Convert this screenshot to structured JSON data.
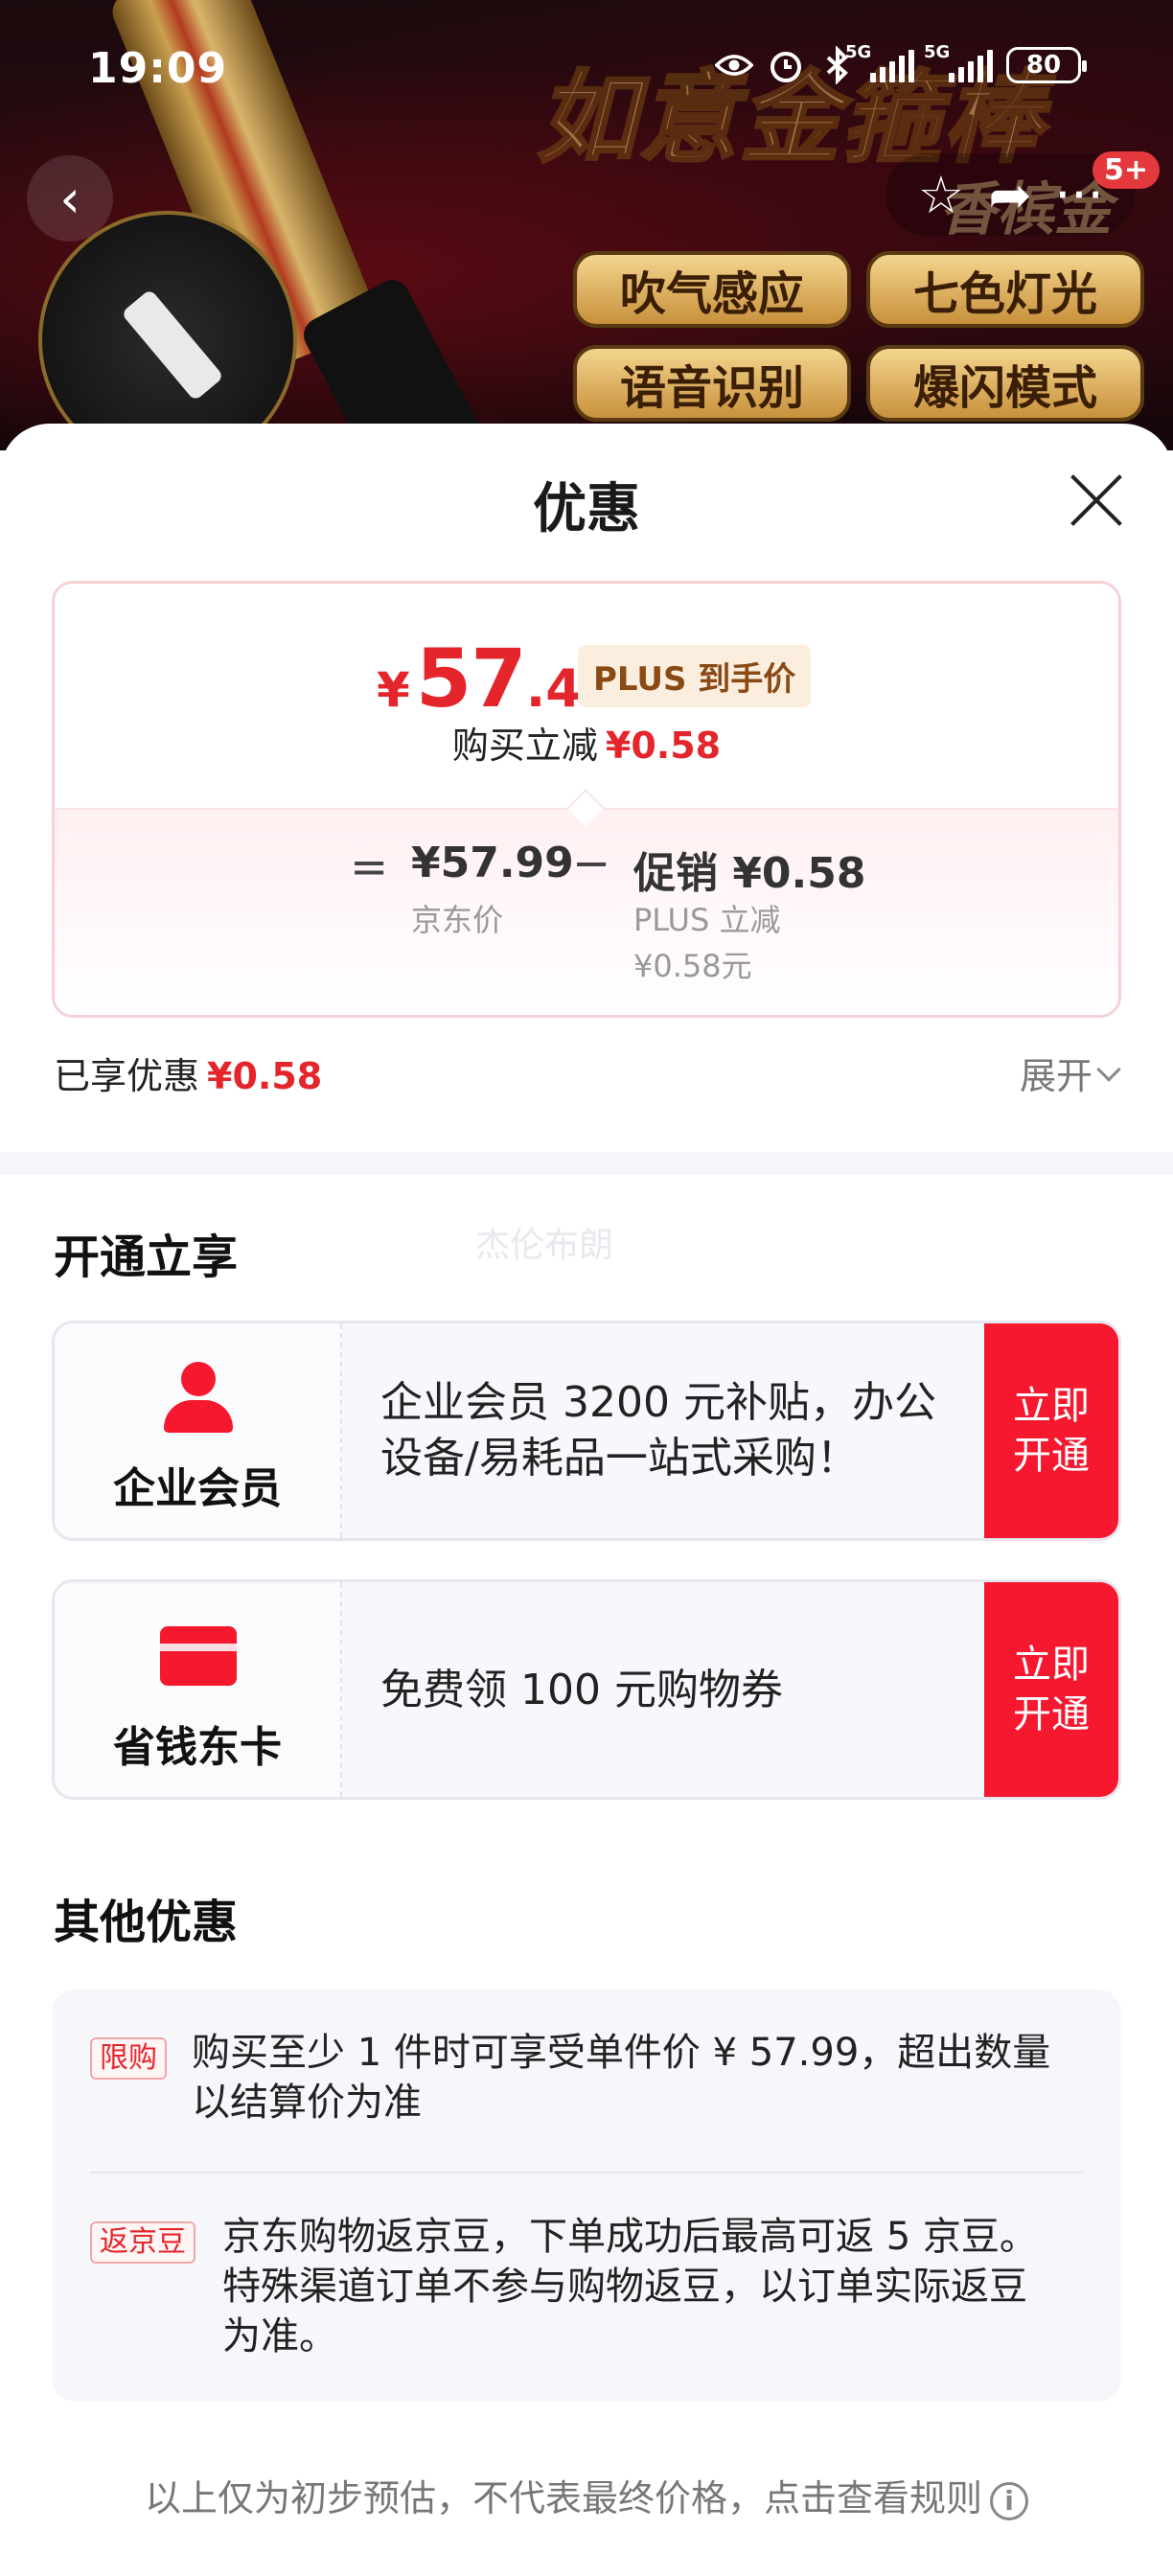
{
  "status_bar": {
    "time": "19:09",
    "network1": "5G",
    "network2": "5G",
    "battery": "80"
  },
  "banner": {
    "title_art": "如意金箍棒",
    "sub_art": "香槟金",
    "badge_count": "5+",
    "features": [
      "吹气感应",
      "七色灯光",
      "语音识别",
      "爆闪模式"
    ]
  },
  "sheet": {
    "title": "优惠",
    "price": {
      "currency": "¥",
      "integer": "57",
      "decimal": ".41",
      "plus_tag": "PLUS 到手价",
      "reduce_label": "购买立减",
      "reduce_amount": "¥0.58",
      "equals": "=",
      "jd_price": "¥57.99",
      "jd_price_label": "京东价",
      "minus": "−",
      "promo_value": "促销 ¥0.58",
      "promo_sub1": "PLUS 立减",
      "promo_sub2": "¥0.58元"
    },
    "enjoyed_label": "已享优惠",
    "enjoyed_amount": "¥0.58",
    "expand_label": "展开"
  },
  "open_section": {
    "title": "开通立享",
    "watermark": "杰伦布朗",
    "cards": [
      {
        "name": "企业会员",
        "icon": "user-icon",
        "desc_line1": "企业会员 3200 元补贴，办公",
        "desc_line2": "设备/易耗品一站式采购！",
        "cta_line1": "立即",
        "cta_line2": "开通"
      },
      {
        "name": "省钱东卡",
        "icon": "card-icon",
        "desc_line1": "免费领 100 元购物券",
        "cta_line1": "立即",
        "cta_line2": "开通"
      }
    ]
  },
  "other_section": {
    "title": "其他优惠",
    "items": [
      {
        "tag": "限购",
        "line1": "购买至少 1 件时可享受单件价 ¥ 57.99，超出数量",
        "line2": "以结算价为准"
      },
      {
        "tag": "返京豆",
        "line1": "京东购物返京豆，下单成功后最高可返 5 京豆。",
        "line2": "特殊渠道订单不参与购物返豆，以订单实际返豆",
        "line3": "为准。"
      }
    ]
  },
  "footer": {
    "note": "以上仅为初步预估，不代表最终价格，点击查看规则",
    "info_symbol": "i"
  },
  "colors": {
    "accent_red": "#e4252b",
    "cta_red": "#f5182f",
    "plus_gold": "#8a4a16"
  }
}
